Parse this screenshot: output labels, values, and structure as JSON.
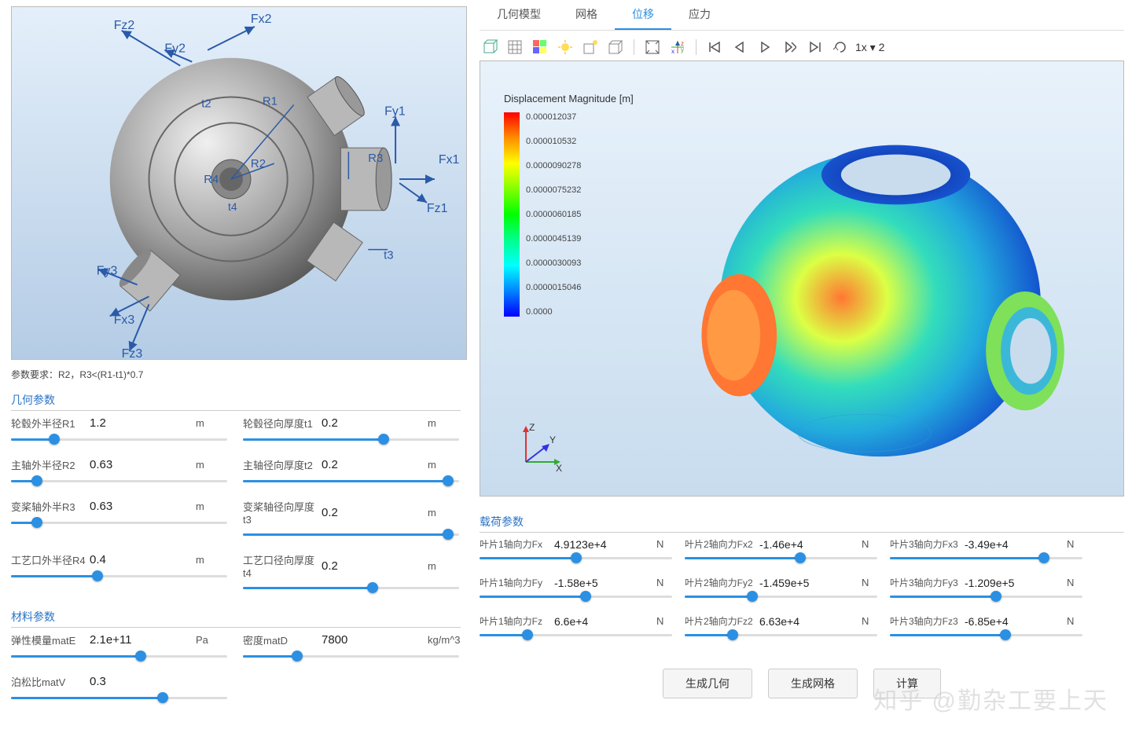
{
  "watermark": "知乎 @勤杂工要上天",
  "cad": {
    "param_req": "参数要求：R2，R3<(R1-t1)*0.7",
    "labels": {
      "Fx1": "Fx1",
      "Fy1": "Fy1",
      "Fz1": "Fz1",
      "Fx2": "Fx2",
      "Fy2": "Fy2",
      "Fz2": "Fz2",
      "Fx3": "Fx3",
      "Fy3": "Fy3",
      "Fz3": "Fz3",
      "R1": "R1",
      "R2": "R2",
      "R3": "R3",
      "R4": "R4",
      "t2": "t2",
      "t3": "t3",
      "t4": "t4"
    }
  },
  "sections": {
    "geom": "几何参数",
    "mat": "材料参数",
    "load": "载荷参数"
  },
  "geom_params": [
    {
      "label": "轮毂外半径R1",
      "val": "1.2",
      "unit": "m",
      "pct": 20
    },
    {
      "label": "轮毂径向厚度t1",
      "val": "0.2",
      "unit": "m",
      "pct": 65
    },
    {
      "label": "主轴外半径R2",
      "val": "0.63",
      "unit": "m",
      "pct": 12
    },
    {
      "label": "主轴径向厚度t2",
      "val": "0.2",
      "unit": "m",
      "pct": 95
    },
    {
      "label": "变桨轴外半R3",
      "val": "0.63",
      "unit": "m",
      "pct": 12
    },
    {
      "label": "变桨轴径向厚度t3",
      "val": "0.2",
      "unit": "m",
      "pct": 95
    },
    {
      "label": "工艺口外半径R4",
      "val": "0.4",
      "unit": "m",
      "pct": 40
    },
    {
      "label": "工艺口径向厚度t4",
      "val": "0.2",
      "unit": "m",
      "pct": 60
    }
  ],
  "mat_params": [
    {
      "label": "弹性模量matE",
      "val": "2.1e+11",
      "unit": "Pa",
      "pct": 60
    },
    {
      "label": "密度matD",
      "val": "7800",
      "unit": "kg/m^3",
      "pct": 25
    },
    {
      "label": "泊松比matV",
      "val": "0.3",
      "unit": "",
      "pct": 70
    }
  ],
  "tabs": [
    {
      "label": "几何模型",
      "active": false
    },
    {
      "label": "网格",
      "active": false
    },
    {
      "label": "位移",
      "active": true
    },
    {
      "label": "应力",
      "active": false
    }
  ],
  "toolbar": {
    "speed": "1x ▾  2"
  },
  "legend": {
    "title": "Displacement Magnitude [m]",
    "values": [
      "0.000012037",
      "0.000010532",
      "0.0000090278",
      "0.0000075232",
      "0.0000060185",
      "0.0000045139",
      "0.0000030093",
      "0.0000015046",
      "0.0000"
    ]
  },
  "load_params": [
    {
      "label": "叶片1轴向力Fx",
      "val": "4.9123e+4",
      "unit": "N",
      "pct": 50
    },
    {
      "label": "叶片2轴向力Fx2",
      "val": "-1.46e+4",
      "unit": "N",
      "pct": 60
    },
    {
      "label": "叶片3轴向力Fx3",
      "val": "-3.49e+4",
      "unit": "N",
      "pct": 80
    },
    {
      "label": "叶片1轴向力Fy",
      "val": "-1.58e+5",
      "unit": "N",
      "pct": 55
    },
    {
      "label": "叶片2轴向力Fy2",
      "val": "-1.459e+5",
      "unit": "N",
      "pct": 35
    },
    {
      "label": "叶片3轴向力Fy3",
      "val": "-1.209e+5",
      "unit": "N",
      "pct": 55
    },
    {
      "label": "叶片1轴向力Fz",
      "val": "6.6e+4",
      "unit": "N",
      "pct": 25
    },
    {
      "label": "叶片2轴向力Fz2",
      "val": "6.63e+4",
      "unit": "N",
      "pct": 25
    },
    {
      "label": "叶片3轴向力Fz3",
      "val": "-6.85e+4",
      "unit": "N",
      "pct": 60
    }
  ],
  "buttons": {
    "gen_geom": "生成几何",
    "gen_mesh": "生成网格",
    "compute": "计算"
  },
  "axes": {
    "x": "X",
    "y": "Y",
    "z": "Z"
  }
}
